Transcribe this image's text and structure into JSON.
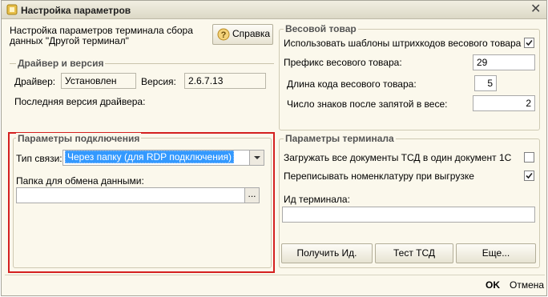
{
  "window": {
    "title": "Настройка параметров"
  },
  "intro": {
    "line1": "Настройка параметров терминала сбора",
    "line2": "данных \"Другой терминал\""
  },
  "help_button": {
    "label": "Справка"
  },
  "driver_group": {
    "title": "Драйвер и версия",
    "driver_label": "Драйвер:",
    "driver_value": "Установлен",
    "version_label": "Версия:",
    "version_value": "2.6.7.13",
    "latest_label": "Последняя версия драйвера:"
  },
  "connection_group": {
    "title": "Параметры подключения",
    "link_type_label": "Тип связи:",
    "link_type_value": "Через папку (для RDP подключения)",
    "folder_label": "Папка для обмена данными:",
    "folder_value": "",
    "browse_label": "..."
  },
  "weight_group": {
    "title": "Весовой товар",
    "use_templates_label": "Использовать шаблоны штрихкодов весового товара",
    "use_templates_checked": true,
    "prefix_label": "Префикс весового товара:",
    "prefix_value": "29",
    "code_length_label": "Длина кода весового товара:",
    "code_length_value": "5",
    "decimals_label": "Число знаков после запятой в весе:",
    "decimals_value": "2"
  },
  "terminal_group": {
    "title": "Параметры терминала",
    "load_all_label": "Загружать все документы ТСД в один документ 1С",
    "load_all_checked": false,
    "rewrite_label": "Переписывать номенклатуру при выгрузке",
    "rewrite_checked": true,
    "terminal_id_label": "Ид терминала:",
    "terminal_id_value": "",
    "get_id_button": "Получить Ид.",
    "test_button": "Тест ТСД",
    "more_button": "Еще..."
  },
  "footer": {
    "ok": "OK",
    "cancel": "Отмена"
  },
  "colors": {
    "highlight": "#d42020",
    "selection": "#3399ff",
    "window_bg": "#fbf8ec"
  }
}
